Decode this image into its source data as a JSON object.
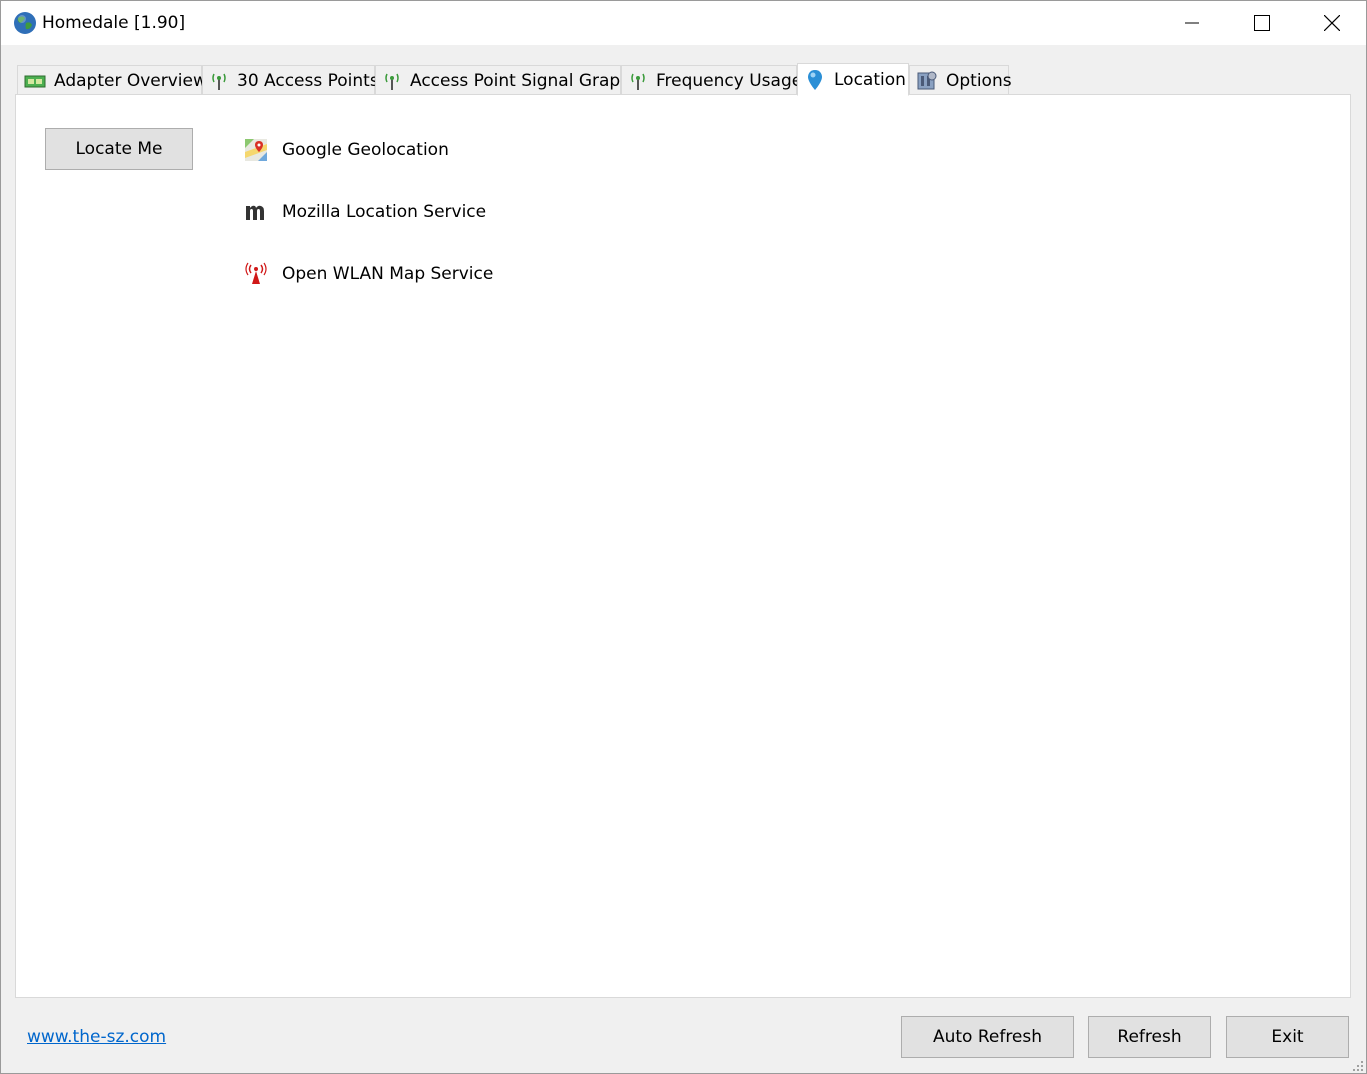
{
  "window": {
    "title": "Homedale [1.90]"
  },
  "tabs": [
    {
      "label": "Adapter Overview",
      "icon": "adapter-icon"
    },
    {
      "label": "30 Access Points",
      "icon": "antenna-icon"
    },
    {
      "label": "Access Point Signal Graph",
      "icon": "antenna-icon"
    },
    {
      "label": "Frequency Usage",
      "icon": "antenna-icon"
    },
    {
      "label": "Location",
      "icon": "location-pin-icon",
      "active": true
    },
    {
      "label": "Options",
      "icon": "options-icon"
    }
  ],
  "location": {
    "locate_button": "Locate Me",
    "services": [
      {
        "label": "Google Geolocation",
        "icon": "google-maps-icon"
      },
      {
        "label": "Mozilla Location Service",
        "icon": "mozilla-m-icon"
      },
      {
        "label": "Open WLAN Map Service",
        "icon": "wlan-tower-icon"
      }
    ]
  },
  "footer": {
    "link": "www.the-sz.com",
    "auto_refresh": "Auto Refresh",
    "refresh": "Refresh",
    "exit": "Exit"
  },
  "colors": {
    "link": "#0066cc",
    "accent_green": "#3a9a3a",
    "pin_blue": "#2b8fd6"
  }
}
